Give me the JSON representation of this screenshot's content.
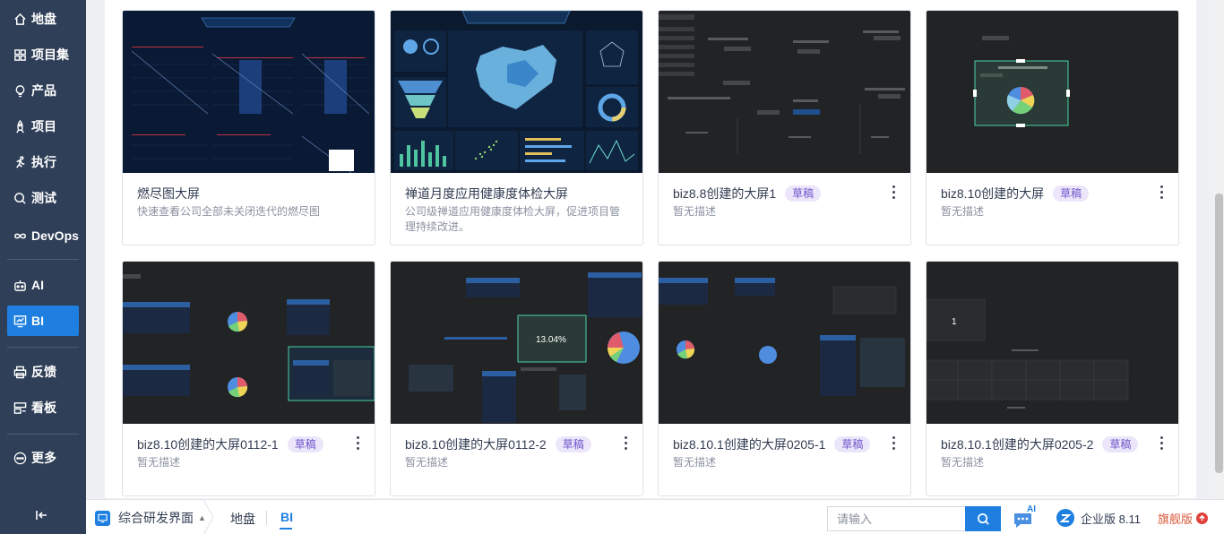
{
  "sidebar": {
    "items": [
      {
        "label": "地盘",
        "icon": "home-icon"
      },
      {
        "label": "项目集",
        "icon": "grid-icon"
      },
      {
        "label": "产品",
        "icon": "bulb-icon"
      },
      {
        "label": "项目",
        "icon": "rocket-icon"
      },
      {
        "label": "执行",
        "icon": "run-icon"
      },
      {
        "label": "测试",
        "icon": "test-icon"
      },
      {
        "label": "DevOps",
        "icon": "infinity-icon"
      },
      {
        "label": "AI",
        "icon": "robot-icon"
      },
      {
        "label": "BI",
        "icon": "chart-icon",
        "active": true
      },
      {
        "label": "反馈",
        "icon": "printer-icon"
      },
      {
        "label": "看板",
        "icon": "kanban-icon"
      },
      {
        "label": "更多",
        "icon": "more-circle-icon"
      }
    ],
    "collapse_icon": "collapse-left-icon"
  },
  "cards": [
    {
      "title": "燃尽图大屏",
      "badge": "",
      "desc": "快速查看公司全部未关闭迭代的燃尽图",
      "has_more": false
    },
    {
      "title": "禅道月度应用健康度体检大屏",
      "badge": "",
      "desc": "公司级禅道应用健康度体检大屏，促进项目管理持续改进。",
      "has_more": false
    },
    {
      "title": "biz8.8创建的大屏1",
      "badge": "草稿",
      "desc": "暂无描述",
      "has_more": true
    },
    {
      "title": "biz8.10创建的大屏",
      "badge": "草稿",
      "desc": "暂无描述",
      "has_more": true
    },
    {
      "title": "biz8.10创建的大屏0112-1",
      "badge": "草稿",
      "desc": "暂无描述",
      "has_more": true
    },
    {
      "title": "biz8.10创建的大屏0112-2",
      "badge": "草稿",
      "desc": "暂无描述",
      "has_more": true
    },
    {
      "title": "biz8.10.1创建的大屏0205-1",
      "badge": "草稿",
      "desc": "暂无描述",
      "has_more": true
    },
    {
      "title": "biz8.10.1创建的大屏0205-2",
      "badge": "草稿",
      "desc": "暂无描述",
      "has_more": true
    }
  ],
  "thumb_texts": {
    "percent": "13.04%",
    "one": "1"
  },
  "bottombar": {
    "workspace": "综合研发界面",
    "crumbs": [
      "地盘",
      "BI"
    ],
    "search_placeholder": "请输入",
    "ai_label": "AI",
    "edition": "企业版 8.11",
    "flagship": "旗舰版"
  },
  "colors": {
    "sidebar_bg": "#2f3f58",
    "accent": "#1e7fe0",
    "badge_bg": "#ece6fb",
    "badge_text": "#6d55c9"
  }
}
